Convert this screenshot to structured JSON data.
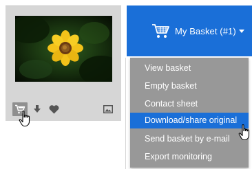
{
  "card": {
    "actions": [
      {
        "icon": "shopping-cart-icon",
        "active": true
      },
      {
        "icon": "download-icon",
        "active": false
      },
      {
        "icon": "heart-icon",
        "active": false
      },
      {
        "icon": "image-icon",
        "active": false
      }
    ]
  },
  "basket": {
    "label": "My Basket (#1)",
    "icon": "shopping-cart-icon",
    "caret": "chevron-down-icon"
  },
  "menu": {
    "items": [
      {
        "label": "View basket",
        "active": false
      },
      {
        "label": "Empty basket",
        "active": false
      },
      {
        "label": "Contact sheet",
        "active": false
      },
      {
        "label": "Download/share original",
        "active": true
      },
      {
        "label": "Send basket by e-mail",
        "active": false
      },
      {
        "label": "Export monitoring",
        "active": false
      }
    ]
  },
  "colors": {
    "accent": "#1a6fd8",
    "menu_bg": "#989898",
    "card_bg": "#d6d6d6",
    "icon_gray": "#555555"
  }
}
